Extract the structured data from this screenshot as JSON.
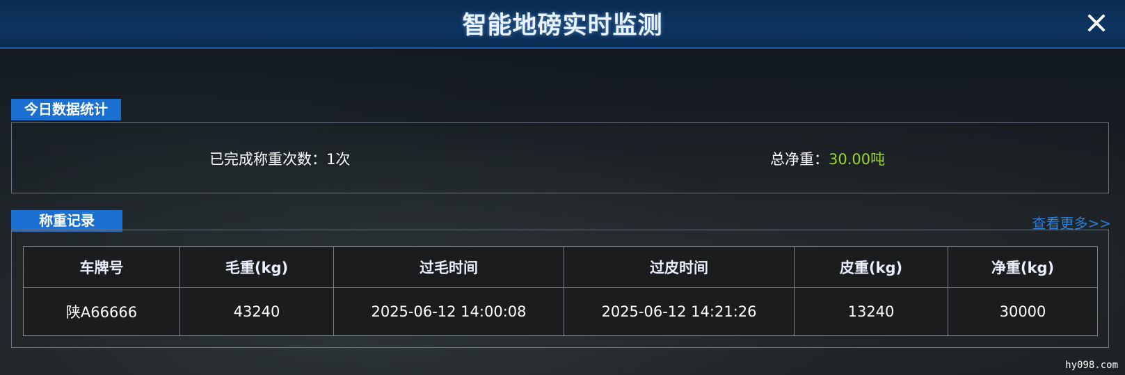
{
  "header": {
    "title": "智能地磅实时监测"
  },
  "stats": {
    "tab_label": "今日数据统计",
    "completed_label": "已完成称重次数：",
    "completed_value": "1次",
    "net_weight_label": "总净重：",
    "net_weight_value": "30.00吨"
  },
  "records": {
    "tab_label": "称重记录",
    "view_more": "查看更多>>",
    "columns": [
      "车牌号",
      "毛重(kg)",
      "过毛时间",
      "过皮时间",
      "皮重(kg)",
      "净重(kg)"
    ],
    "rows": [
      {
        "plate": "陕A66666",
        "gross": "43240",
        "gross_time": "2025-06-12 14:00:08",
        "tare_time": "2025-06-12 14:21:26",
        "tare": "13240",
        "net": "30000"
      }
    ]
  },
  "watermark": "hy098.com",
  "colors": {
    "header_bg": "#0d3561",
    "tab_bg": "#1a6fd0",
    "accent_green": "#9bd72b",
    "link_blue": "#2a7fd8"
  },
  "icons": {
    "close": "close-icon"
  }
}
